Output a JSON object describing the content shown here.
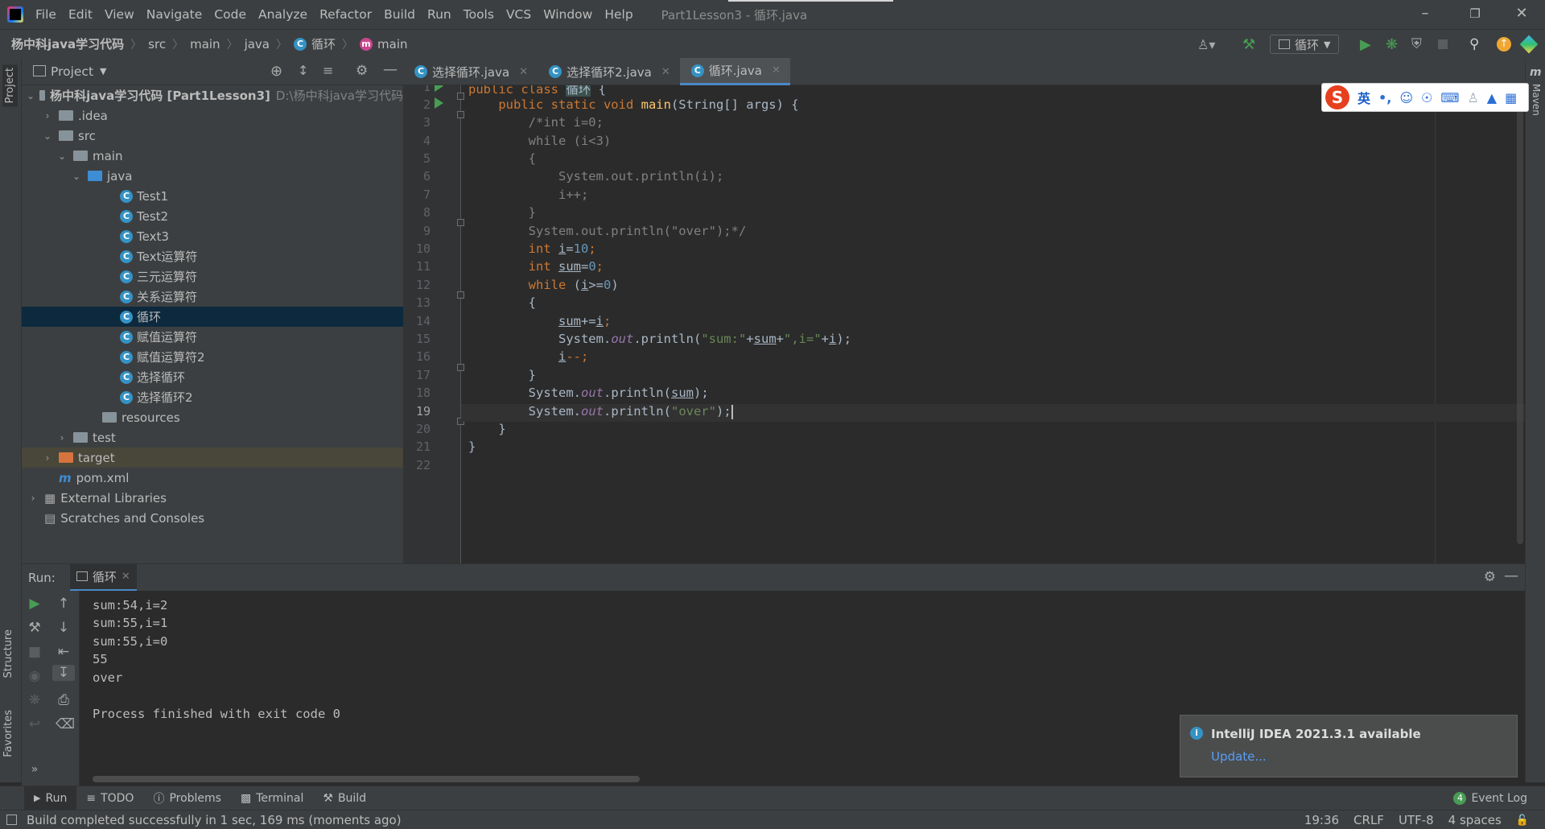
{
  "menubar": {
    "items": [
      "File",
      "Edit",
      "View",
      "Navigate",
      "Code",
      "Analyze",
      "Refactor",
      "Build",
      "Run",
      "Tools",
      "VCS",
      "Window",
      "Help"
    ],
    "window_title": "Part1Lesson3 - 循环.java"
  },
  "breadcrumb": {
    "root": "杨中科java学习代码",
    "items": [
      "src",
      "main",
      "java",
      "循环",
      "main"
    ]
  },
  "toolbar": {
    "run_config": "循环"
  },
  "project": {
    "title": "Project",
    "tree": [
      {
        "label": "杨中科java学习代码 [Part1Lesson3]",
        "path": "D:\\杨中科java学习代码"
      },
      {
        "label": ".idea"
      },
      {
        "label": "src"
      },
      {
        "label": "main"
      },
      {
        "label": "java"
      },
      {
        "label": "Test1"
      },
      {
        "label": "Test2"
      },
      {
        "label": "Text3"
      },
      {
        "label": "Text运算符"
      },
      {
        "label": "三元运算符"
      },
      {
        "label": "关系运算符"
      },
      {
        "label": "循环"
      },
      {
        "label": "赋值运算符"
      },
      {
        "label": "赋值运算符2"
      },
      {
        "label": "选择循环"
      },
      {
        "label": "选择循环2"
      },
      {
        "label": "resources"
      },
      {
        "label": "test"
      },
      {
        "label": "target"
      },
      {
        "label": "pom.xml"
      },
      {
        "label": "External Libraries"
      },
      {
        "label": "Scratches and Consoles"
      }
    ]
  },
  "editor": {
    "tabs": [
      "选择循环.java",
      "选择循环2.java",
      "循环.java"
    ],
    "active_tab": "循环.java",
    "line_numbers": [
      "1",
      "2",
      "3",
      "4",
      "5",
      "6",
      "7",
      "8",
      "9",
      "10",
      "11",
      "12",
      "13",
      "14",
      "15",
      "16",
      "17",
      "18",
      "19",
      "20",
      "21",
      "22"
    ],
    "code": {
      "l1_kw": "public class ",
      "l1_name": "循环",
      "l1_rest": " {",
      "l2_kw": "    public static void ",
      "l2_fn": "main",
      "l2_rest": "(String[] args) {",
      "l3": "        /*int i=0;",
      "l4": "        while (i<3)",
      "l5": "        {",
      "l6": "            System.out.println(i);",
      "l7": "            i++;",
      "l8": "        }",
      "l9": "        System.out.println(\"over\");*/",
      "l10_kw": "        int ",
      "l10_var": "i",
      "l10_eq": "=",
      "l10_num": "10",
      "l10_end": ";",
      "l11_kw": "        int ",
      "l11_var": "sum",
      "l11_eq": "=",
      "l11_num": "0",
      "l11_end": ";",
      "l12_kw": "        while ",
      "l12_a": "(",
      "l12_var": "i",
      "l12_b": ">=",
      "l12_num": "0",
      "l12_c": ")",
      "l13": "        {",
      "l14_pre": "            ",
      "l14_var": "sum",
      "l14_mid": "+=",
      "l14_var2": "i",
      "l14_end": ";",
      "l15_pre": "            System.",
      "l15_out": "out",
      "l15_mid": ".println(",
      "l15_s1": "\"sum:\"",
      "l15_p1": "+",
      "l15_v1": "sum",
      "l15_p2": "+",
      "l15_s2": "\",i=\"",
      "l15_p3": "+",
      "l15_v2": "i",
      "l15_end": ");",
      "l16_pre": "            ",
      "l16_var": "i",
      "l16_end": "--;",
      "l17": "        }",
      "l18_pre": "        System.",
      "l18_out": "out",
      "l18_mid": ".println(",
      "l18_var": "sum",
      "l18_end": ");",
      "l19_pre": "        System.",
      "l19_out": "out",
      "l19_mid": ".println(",
      "l19_s": "\"over\"",
      "l19_end": ");",
      "l20": "    }",
      "l21": "}"
    }
  },
  "ime": {
    "mode": "英"
  },
  "run": {
    "label": "Run:",
    "tab": "循环",
    "output": [
      "sum:54,i=2",
      "sum:55,i=1",
      "sum:55,i=0",
      "55",
      "over",
      "",
      "Process finished with exit code 0"
    ]
  },
  "notification": {
    "title": "IntelliJ IDEA 2021.3.1 available",
    "link": "Update..."
  },
  "bottom_tabs": [
    "Run",
    "TODO",
    "Problems",
    "Terminal",
    "Build"
  ],
  "event_log": {
    "label": "Event Log",
    "count": "4"
  },
  "left_strip": {
    "project": "Project",
    "structure": "Structure",
    "favorites": "Favorites"
  },
  "right_strip": {
    "maven": "Maven"
  },
  "status": {
    "message": "Build completed successfully in 1 sec, 169 ms (moments ago)",
    "position": "19:36",
    "line_sep": "CRLF",
    "encoding": "UTF-8",
    "indent": "4 spaces"
  }
}
